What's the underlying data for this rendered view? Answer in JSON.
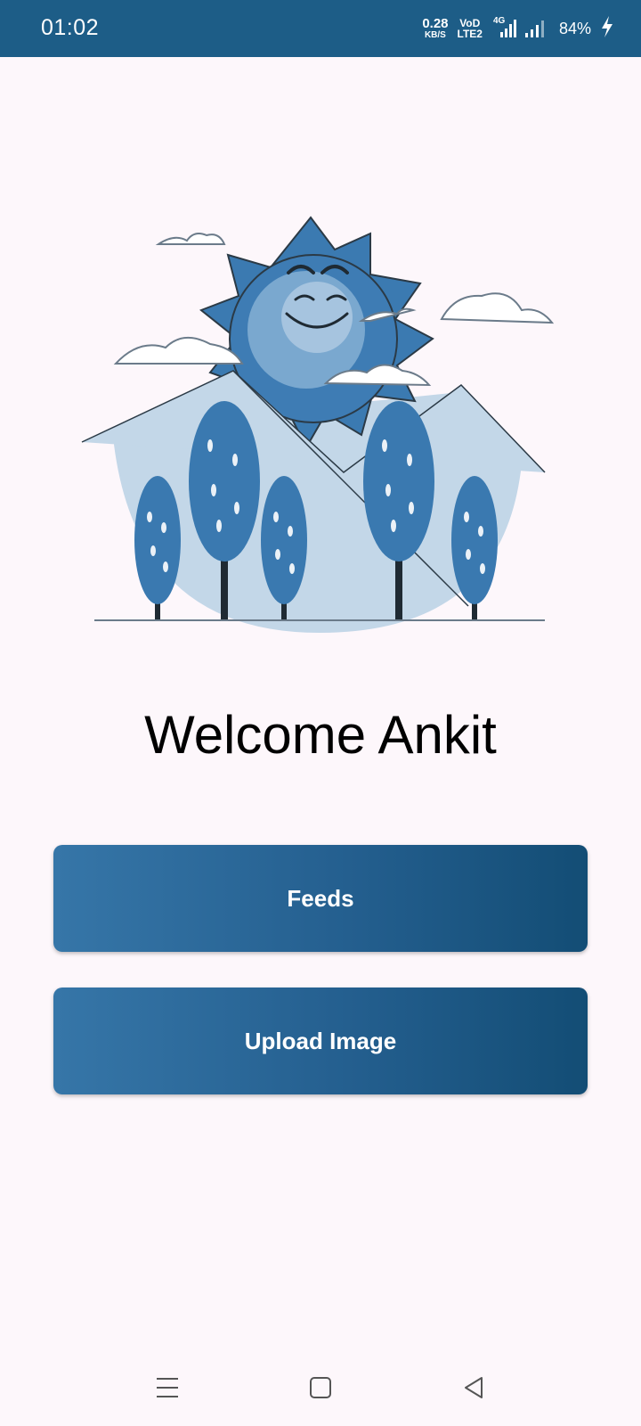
{
  "status_bar": {
    "time": "01:02",
    "net_speed_value": "0.28",
    "net_speed_unit": "KB/S",
    "volte_top": "VoD",
    "volte_bottom": "LTE2",
    "network_type": "4G",
    "battery_percent": "84%"
  },
  "main": {
    "welcome_text": "Welcome Ankit",
    "feeds_button_label": "Feeds",
    "upload_button_label": "Upload Image"
  },
  "colors": {
    "status_bar_bg": "#1d5d87",
    "button_gradient_start": "#3676a8",
    "button_gradient_end": "#134d75",
    "page_bg": "#fdf7fb"
  },
  "icons": {
    "status": [
      "signal-icon",
      "battery-charging-icon"
    ],
    "nav": [
      "menu-icon",
      "home-icon",
      "back-icon"
    ]
  }
}
